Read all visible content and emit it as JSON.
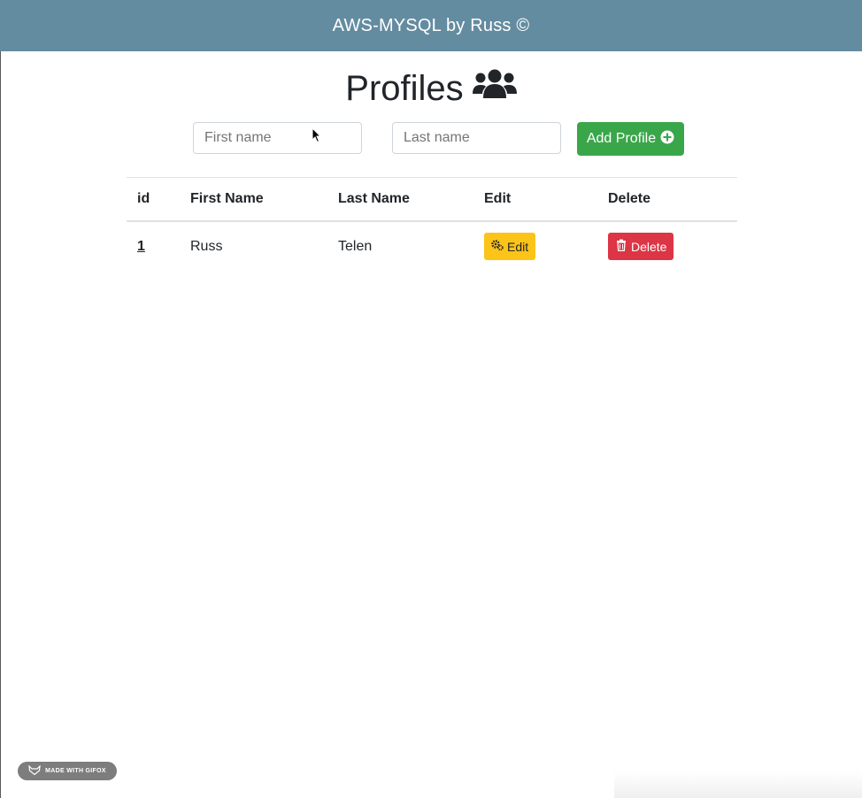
{
  "navbar": {
    "title": "AWS-MYSQL by Russ ©"
  },
  "page": {
    "heading": "Profiles",
    "heading_icon": "users-icon"
  },
  "form": {
    "first_name_placeholder": "First name",
    "last_name_placeholder": "Last name",
    "add_button_label": "Add Profile",
    "add_button_icon": "plus-circle-icon"
  },
  "table": {
    "columns": [
      "id",
      "First Name",
      "Last Name",
      "Edit",
      "Delete"
    ],
    "rows": [
      {
        "id": "1",
        "first_name": "Russ",
        "last_name": "Telen",
        "edit_label": "Edit",
        "delete_label": "Delete"
      }
    ]
  },
  "badge": {
    "text": "MADE WITH GIFOX"
  },
  "colors": {
    "navbar": "#648ca0",
    "add_button": "#3aa64a",
    "edit_button": "#fcc419",
    "delete_button": "#dc3545"
  }
}
